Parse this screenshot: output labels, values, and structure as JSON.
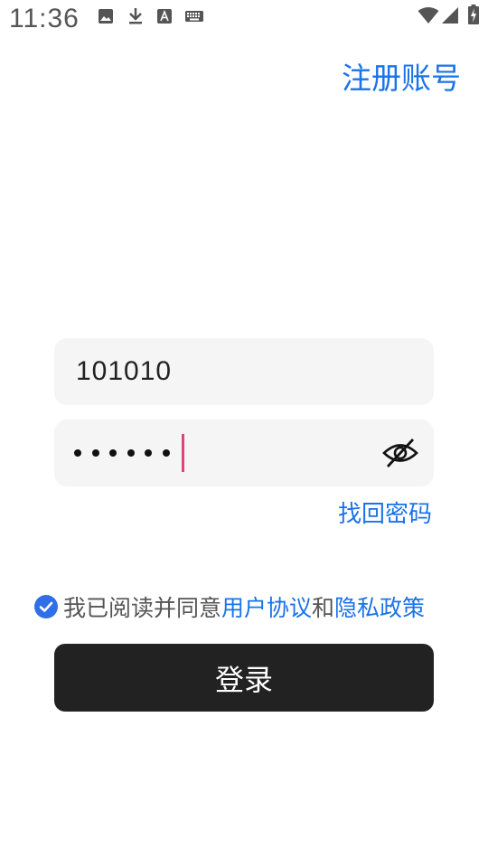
{
  "status_bar": {
    "time": "11:36",
    "left_icons": [
      "image-icon",
      "download-icon",
      "font-a-icon",
      "keyboard-icon"
    ],
    "right_icons": [
      "wifi-icon",
      "signal-icon",
      "battery-charging-icon"
    ]
  },
  "header": {
    "register_label": "注册账号"
  },
  "form": {
    "account_value": "101010",
    "password_mask_length": 6,
    "password_toggle_icon": "eye-off-icon",
    "forgot_password_label": "找回密码"
  },
  "agreement": {
    "checked": true,
    "prefix": "我已阅读并同意",
    "user_agreement_label": "用户协议",
    "joiner": "和",
    "privacy_policy_label": "隐私政策"
  },
  "login_button_label": "登录",
  "colors": {
    "accent": "#1a73e8",
    "button_bg": "#222222",
    "field_bg": "#f5f5f5",
    "caret": "#e0447e",
    "checkbox": "#2f6fe8"
  }
}
